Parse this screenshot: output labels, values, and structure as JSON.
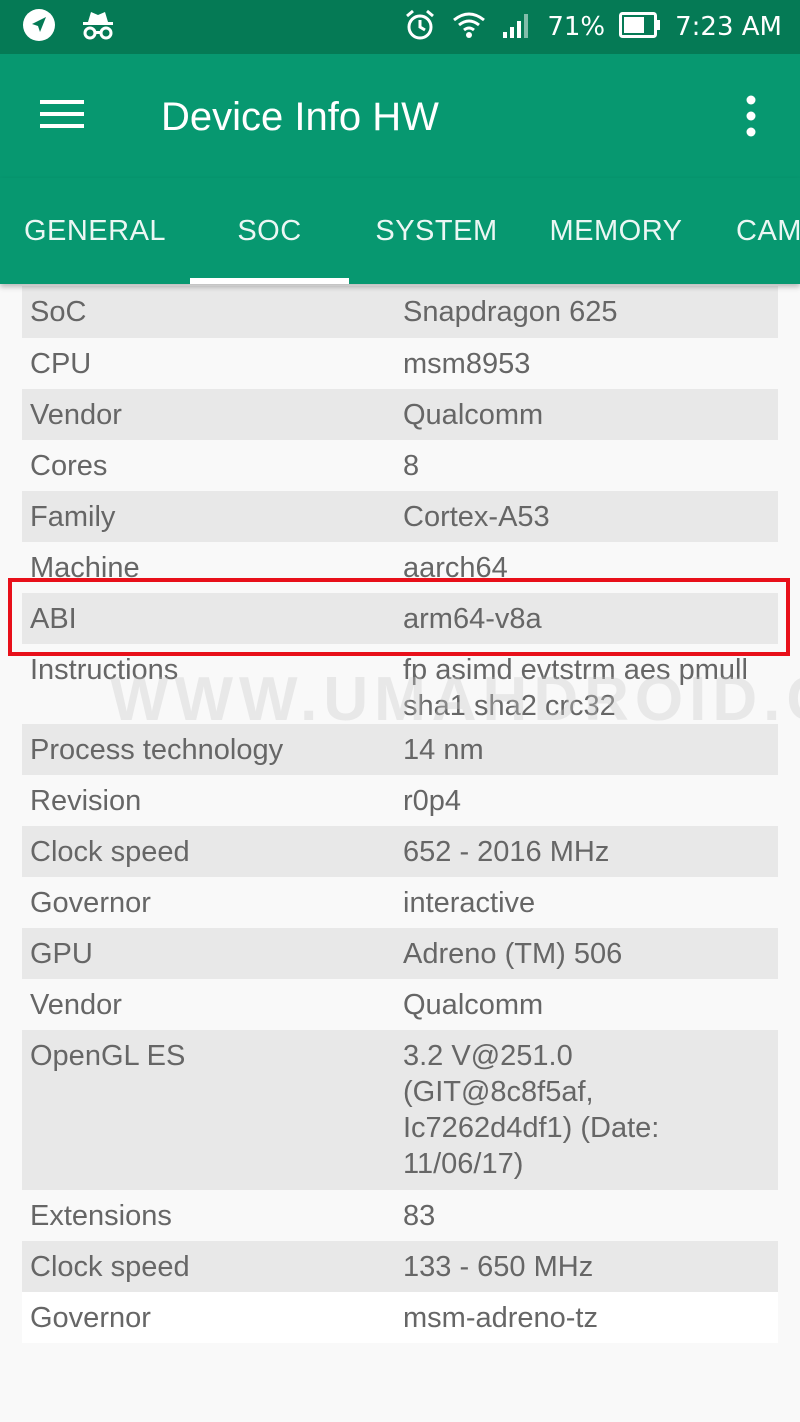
{
  "status_bar": {
    "battery_percent": "71%",
    "time": "7:23 AM",
    "icons": [
      "navigation-icon",
      "incognito-icon",
      "alarm-icon",
      "wifi-icon",
      "signal-icon",
      "battery-icon"
    ]
  },
  "app": {
    "title": "Device Info HW"
  },
  "tabs": [
    {
      "label": "GENERAL",
      "selected": false
    },
    {
      "label": "SOC",
      "selected": true
    },
    {
      "label": "SYSTEM",
      "selected": false
    },
    {
      "label": "MEMORY",
      "selected": false
    },
    {
      "label": "CAM",
      "selected": false
    }
  ],
  "rows": [
    {
      "key": "SoC",
      "value": "Snapdragon 625"
    },
    {
      "key": "CPU",
      "value": "msm8953"
    },
    {
      "key": "Vendor",
      "value": "Qualcomm"
    },
    {
      "key": "Cores",
      "value": "8"
    },
    {
      "key": "Family",
      "value": "Cortex-A53"
    },
    {
      "key": "Machine",
      "value": "aarch64"
    },
    {
      "key": "ABI",
      "value": "arm64-v8a"
    },
    {
      "key": "Instructions",
      "value": "fp asimd evtstrm aes pmull sha1 sha2 crc32"
    },
    {
      "key": "Process technology",
      "value": "14 nm"
    },
    {
      "key": "Revision",
      "value": "r0p4"
    },
    {
      "key": "Clock speed",
      "value": "652 - 2016 MHz"
    },
    {
      "key": "Governor",
      "value": "interactive"
    },
    {
      "key": "GPU",
      "value": "Adreno (TM) 506"
    },
    {
      "key": "Vendor",
      "value": "Qualcomm"
    },
    {
      "key": "OpenGL ES",
      "value": "3.2 V@251.0 (GIT@8c8f5af, Ic7262d4df1) (Date: 11/06/17)"
    },
    {
      "key": "Extensions",
      "value": "83"
    },
    {
      "key": "Clock speed",
      "value": "133 - 650 MHz"
    },
    {
      "key": "Governor",
      "value": "msm-adreno-tz"
    }
  ],
  "watermark": "WWW.UMAHDROID.COM",
  "colors": {
    "status_bar": "#057a55",
    "toolbar": "#079870",
    "row_shade": "#e8e8e8",
    "highlight": "#e8101a"
  }
}
